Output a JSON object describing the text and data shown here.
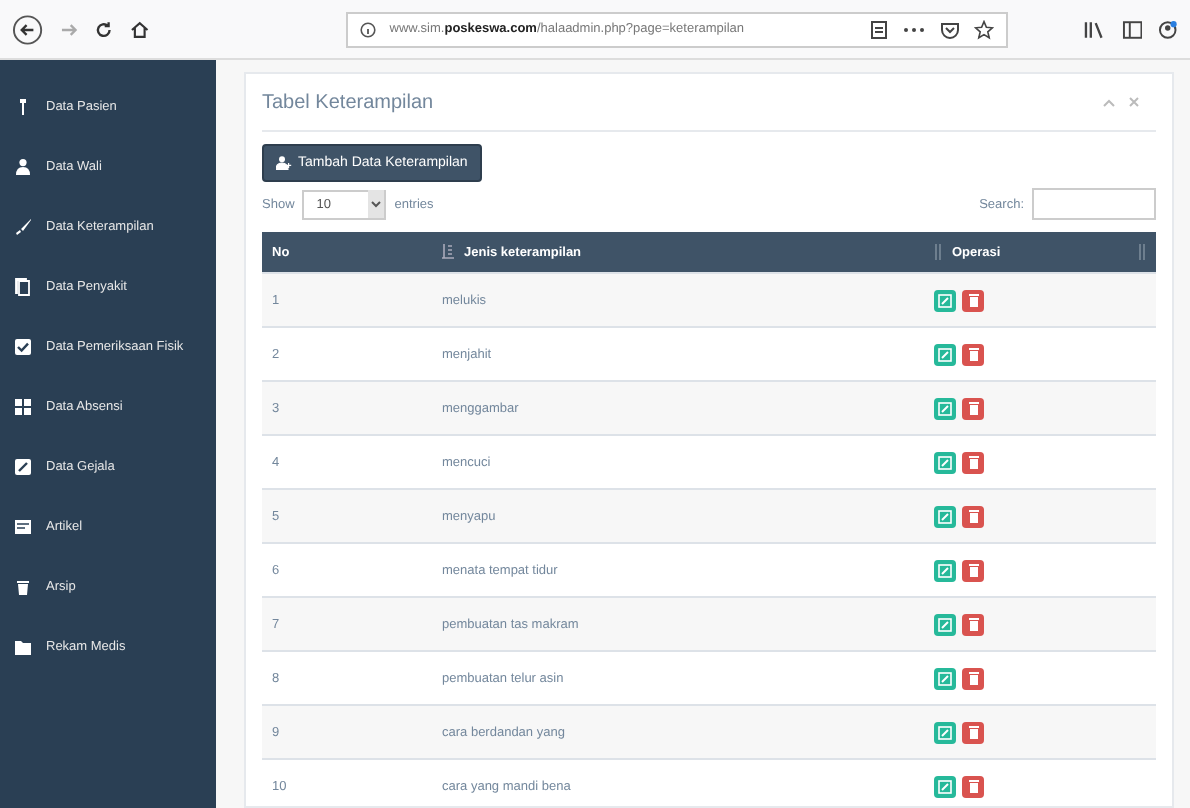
{
  "browser": {
    "url": "www.sim.**poskeswa.com**/halaadmin.php?page=keterampilan"
  },
  "sidebar": {
    "items": [
      {
        "label": "Data Pasien"
      },
      {
        "label": "Data Wali"
      },
      {
        "label": "Data Keterampilan"
      },
      {
        "label": "Data Penyakit"
      },
      {
        "label": "Data Pemeriksaan Fisik"
      },
      {
        "label": "Data Absensi"
      },
      {
        "label": "Data Gejala"
      },
      {
        "label": "Artikel"
      },
      {
        "label": "Arsip"
      },
      {
        "label": "Rekam Medis"
      }
    ]
  },
  "panel": {
    "title": "Tabel Keterampilan",
    "add_button": "Tambah Data Keterampilan",
    "show_label": "Show",
    "page_size": "10",
    "entries_label": "entries",
    "search_label": "Search:"
  },
  "table": {
    "columns": [
      "No",
      "Jenis keterampilan",
      "Operasi"
    ],
    "rows": [
      {
        "no": "1",
        "name": "melukis"
      },
      {
        "no": "2",
        "name": "menjahit"
      },
      {
        "no": "3",
        "name": "menggambar"
      },
      {
        "no": "4",
        "name": "mencuci"
      },
      {
        "no": "5",
        "name": "menyapu"
      },
      {
        "no": "6",
        "name": "menata tempat tidur"
      },
      {
        "no": "7",
        "name": "pembuatan tas makram"
      },
      {
        "no": "8",
        "name": "pembuatan telur asin"
      },
      {
        "no": "9",
        "name": "cara berdandan yang"
      },
      {
        "no": "10",
        "name": "cara yang mandi bena"
      }
    ]
  }
}
